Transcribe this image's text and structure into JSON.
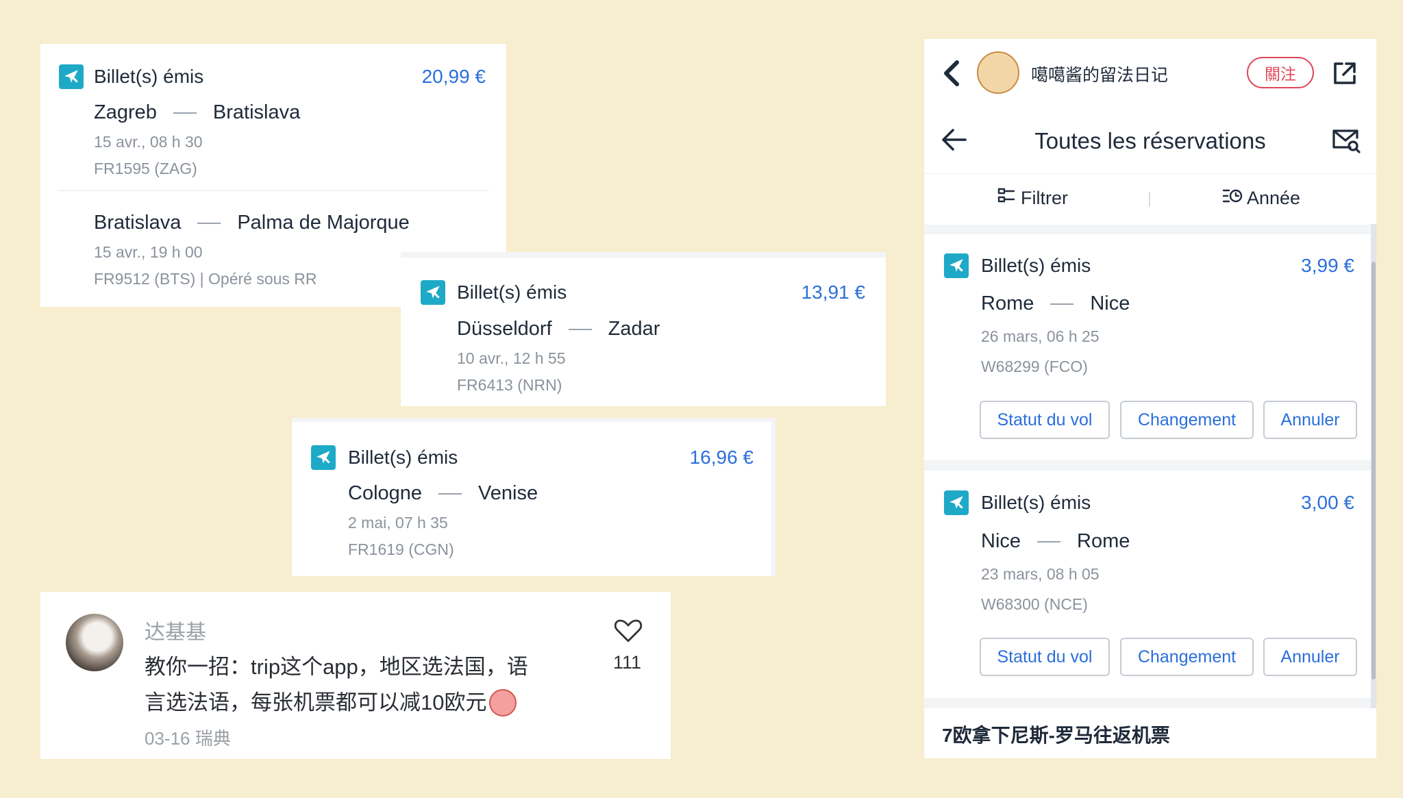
{
  "card1": {
    "status": "Billet(s) émis",
    "price": "20,99 €",
    "leg1": {
      "from": "Zagreb",
      "to": "Bratislava",
      "date": "15 avr., 08 h 30",
      "flight": "FR1595 (ZAG)"
    },
    "leg2": {
      "from": "Bratislava",
      "to": "Palma de Majorque",
      "date": "15 avr., 19 h 00",
      "flight": "FR9512 (BTS) | Opéré sous  RR"
    }
  },
  "card2": {
    "status": "Billet(s) émis",
    "price": "13,91 €",
    "from": "Düsseldorf",
    "to": "Zadar",
    "date": "10 avr., 12 h 55",
    "flight": "FR6413 (NRN)"
  },
  "card3": {
    "status": "Billet(s) émis",
    "price": "16,96 €",
    "from": "Cologne",
    "to": "Venise",
    "date": "2 mai, 07 h 35",
    "flight": "FR1619 (CGN)"
  },
  "comment": {
    "user": "达基基",
    "text_line1": "教你一招：trip这个app，地区选法国，语",
    "text_line2": "言选法语，每张机票都可以减10欧元",
    "meta": "03-16 瑞典",
    "likes": "111"
  },
  "app": {
    "author": "噶噶酱的留法日记",
    "follow_label": "關注",
    "title": "Toutes les réservations",
    "filter_label": "Filtrer",
    "year_label": "Année",
    "bookings": [
      {
        "status": "Billet(s) émis",
        "price": "3,99 €",
        "from": "Rome",
        "to": "Nice",
        "date": "26 mars, 06 h 25",
        "flight": "W68299 (FCO)",
        "btn_status": "Statut du vol",
        "btn_change": "Changement",
        "btn_cancel": "Annuler"
      },
      {
        "status": "Billet(s) émis",
        "price": "3,00 €",
        "from": "Nice",
        "to": "Rome",
        "date": "23 mars, 08 h 05",
        "flight": "W68300 (NCE)",
        "btn_status": "Statut du vol",
        "btn_change": "Changement",
        "btn_cancel": "Annuler"
      }
    ],
    "caption": "7欧拿下尼斯-罗马往返机票"
  },
  "colors": {
    "background": "#f7edcf",
    "accent_blue": "#2a6fdb",
    "plane_badge": "#1ea9c7",
    "follow_red": "#e0475a"
  }
}
